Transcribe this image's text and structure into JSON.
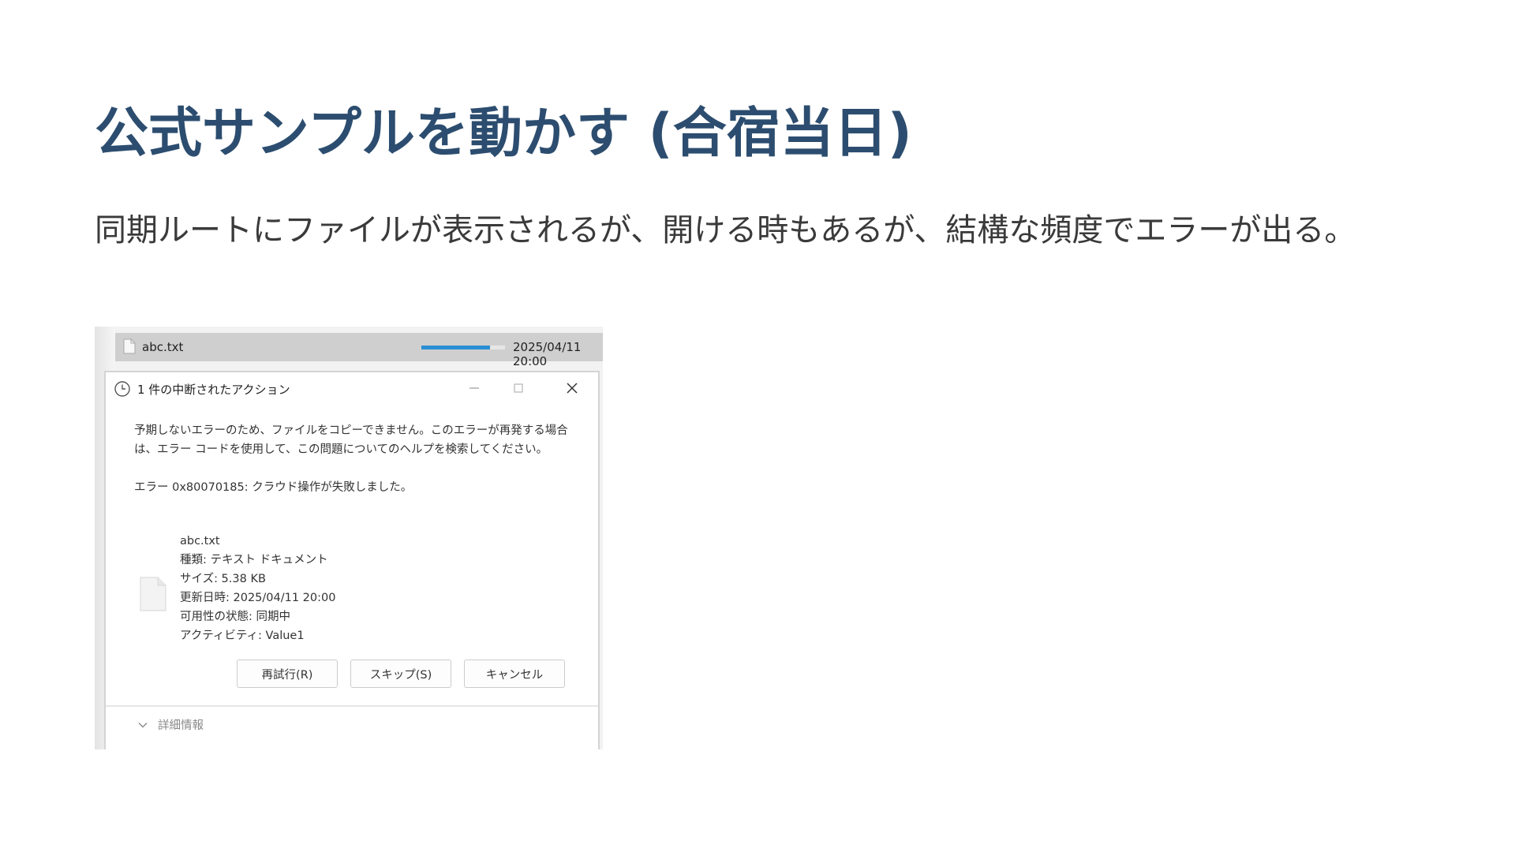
{
  "slide": {
    "title": "公式サンプルを動かす (合宿当日)",
    "body": "同期ルートにファイルが表示されるが、開ける時もあるが、結構な頻度でエラーが出る。"
  },
  "screenshot": {
    "file_row": {
      "name": "abc.txt",
      "date": "2025/04/11 20:00",
      "progress_percent": 82,
      "icon": "document-icon",
      "progress_color": "#2a8fd3"
    },
    "dialog": {
      "title": "1 件の中断されたアクション",
      "title_icon": "clock-icon",
      "message": "予期しないエラーのため、ファイルをコピーできません。このエラーが再発する場合は、エラー コードを使用して、この問題についてのヘルプを検索してください。",
      "error": "エラー 0x80070185: クラウド操作が失敗しました。",
      "file": {
        "name": "abc.txt",
        "type": "種類: テキスト ドキュメント",
        "size": "サイズ: 5.38 KB",
        "modified": "更新日時: 2025/04/11 20:00",
        "availability": "可用性の状態: 同期中",
        "activity": "アクティビティ: Value1",
        "icon": "document-icon"
      },
      "buttons": {
        "retry": "再試行(R)",
        "skip": "スキップ(S)",
        "cancel": "キャンセル"
      },
      "details_label": "詳細情報"
    }
  },
  "colors": {
    "title": "#2c4d6f",
    "body_text": "#3a3a3a",
    "accent": "#2a8fd3"
  }
}
